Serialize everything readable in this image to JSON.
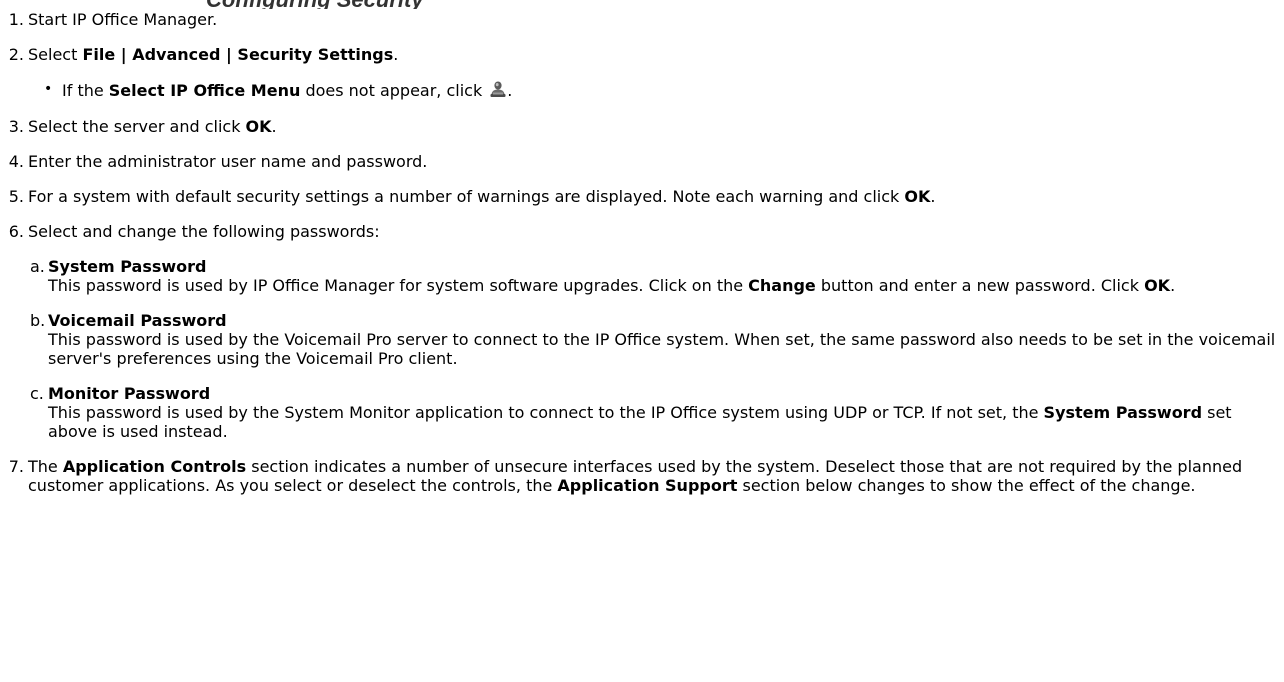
{
  "heading": "Configuring Security",
  "steps": [
    {
      "num": "1.",
      "text": "Start IP Office Manager."
    },
    {
      "num": "2.",
      "pre": "Select ",
      "bold": "File | Advanced | Security Settings",
      "post": "."
    },
    {
      "num": "3.",
      "pre": "Select the server and click ",
      "bold": "OK",
      "post": "."
    },
    {
      "num": "4.",
      "text": "Enter the administrator user name and password."
    },
    {
      "num": "5.",
      "pre": "For a system with default security settings a number of warnings are displayed. Note each warning and click ",
      "bold": "OK",
      "post": "."
    },
    {
      "num": "6.",
      "text": "Select and change the following passwords:"
    },
    {
      "num": "7.",
      "pre": "The ",
      "bold1": "Application Controls",
      "mid": " section indicates a number of unsecure interfaces used by the system. Deselect those that are not required by the planned customer applications. As you select or deselect the controls, the ",
      "bold2": "Application Support",
      "post": " section below changes to show the effect of the change."
    }
  ],
  "step2_bullet": {
    "pre": "If the ",
    "bold": "Select IP Office Menu",
    "post": " does not appear, click ",
    "end": ".",
    "icon": "select-ip-office-icon"
  },
  "passwords": [
    {
      "letter": "a.",
      "title": "System Password",
      "pre": "This password is used by IP Office Manager for system software upgrades. Click on the ",
      "bold": "Change",
      "mid": " button and enter a new password. Click ",
      "bold2": "OK",
      "post": "."
    },
    {
      "letter": "b.",
      "title": "Voicemail Password",
      "text": "This password is used by the Voicemail Pro server to connect to the IP Office system. When set, the same password also needs to be set in the voicemail server's preferences using the Voicemail Pro client."
    },
    {
      "letter": "c.",
      "title": "Monitor Password",
      "pre": "This password is used by the System Monitor application to connect to the IP Office system using UDP or TCP. If not set, the ",
      "bold": "System Password",
      "post": " set above is used instead."
    }
  ],
  "colors": {
    "text": "#000000",
    "heading": "#333333"
  }
}
